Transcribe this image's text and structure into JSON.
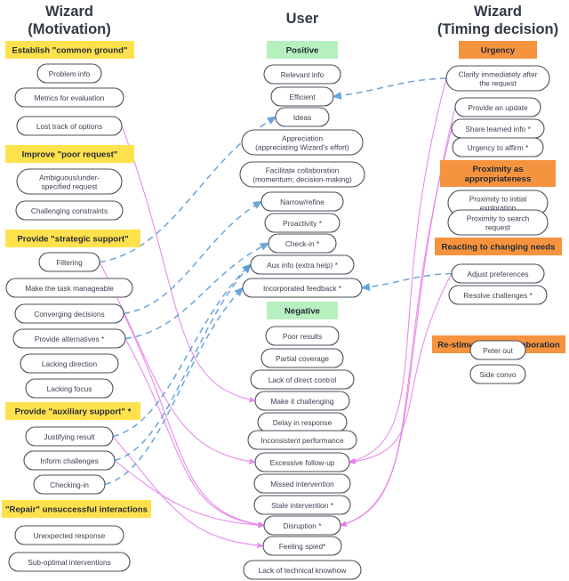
{
  "columns": [
    {
      "id": "wizard-motivation",
      "title": "Wizard\n(Motivation)",
      "title_lines": [
        "Wizard",
        "(Motivation)"
      ],
      "header_color": "#ffe14d",
      "groups": [
        {
          "header": "Establish \"common ground\"",
          "nodes": [
            "Problem info",
            "Metrics for evaluation",
            "Lost track of options"
          ]
        },
        {
          "header": "Improve \"poor request\"",
          "nodes": [
            "Ambiguous/under-\nspecified request",
            "Challenging constraints"
          ]
        },
        {
          "header": "Provide \"strategic support\"",
          "nodes": [
            "Filtering",
            "Make the task manageable",
            "Converging decisions",
            "Provide alternatives *",
            "Lacking direction",
            "Lacking focus"
          ]
        },
        {
          "header": "Provide \"auxiliary support\" *",
          "nodes": [
            "Justifying result",
            "Inform challenges",
            "Checking-in"
          ]
        },
        {
          "header": "\"Repair\" unsuccessful interactions",
          "nodes": [
            "Unexpected response",
            "Sub-optimal interventions"
          ]
        }
      ]
    },
    {
      "id": "user",
      "title": "User",
      "title_lines": [
        "User"
      ],
      "header_color": "#b6f0bf",
      "groups": [
        {
          "header": "Positive",
          "nodes": [
            "Relevant info",
            "Efficient",
            "Ideas",
            "Appreciation\n(appreciating Wizard's effort)",
            "Facilitate collaboration\n(momentum; decision-making)",
            "Narrow/refine",
            "Proactivity *",
            "Check-in *",
            "Aux info (extra help) *",
            "Incorporated feedback *"
          ]
        },
        {
          "header": "Negative",
          "nodes": [
            "Poor results",
            "Partial coverage",
            "Lack of direct control",
            "Make it challenging",
            "Delay in response",
            "Inconsistent performance",
            "Excessive follow-up",
            "Missed intervention",
            "Stale intervention *",
            "Disruption *",
            "Feeling spied*",
            "Lack of technical knowhow"
          ]
        }
      ]
    },
    {
      "id": "wizard-timing",
      "title": "Wizard\n(Timing decision)",
      "title_lines": [
        "Wizard",
        "(Timing decision)"
      ],
      "header_color": "#f5933f",
      "groups": [
        {
          "header": "Urgency",
          "nodes": [
            "Clarify immediately after\nthe request",
            "Provide an update",
            "Share learned info *",
            "Urgency to affirm *"
          ]
        },
        {
          "header": "Proximity as\nappropriateness",
          "nodes": [
            "Proximity to initial\nexploration",
            "Proximity to search\nrequest"
          ]
        },
        {
          "header": "Reacting to changing needs",
          "nodes": [
            "Adjust preferences",
            "Resolve challenges *"
          ]
        },
        {
          "header": "Re-stimulate the collaboration",
          "nodes": [
            "Peter out",
            "Side convo"
          ]
        }
      ]
    }
  ],
  "legend": {
    "pink_link_color": "#e57ae8",
    "blue_link_color": "#5b9bd5",
    "pill_border_color": "#4a4f59",
    "text_color": "#3b4250"
  },
  "links": [
    {
      "from": "Lost track of options",
      "to": "Make it challenging",
      "style": "pink"
    },
    {
      "from": "Filtering",
      "to": "Excessive follow-up",
      "style": "pink"
    },
    {
      "from": "Converging decisions",
      "to": "Disruption *",
      "style": "pink"
    },
    {
      "from": "Provide alternatives *",
      "to": "Disruption *",
      "style": "pink"
    },
    {
      "from": "Justifying result",
      "to": "Feeling spied*",
      "style": "pink"
    },
    {
      "from": "Inform challenges",
      "to": "Disruption *",
      "style": "pink"
    },
    {
      "from": "Clarify immediately after the request",
      "to": "Excessive follow-up",
      "style": "pink"
    },
    {
      "from": "Provide an update",
      "to": "Disruption *",
      "style": "pink"
    },
    {
      "from": "Share learned info *",
      "to": "Disruption *",
      "style": "pink"
    },
    {
      "from": "Adjust preferences",
      "to": "Excessive follow-up",
      "style": "pink"
    },
    {
      "from": "Clarify immediately after the request",
      "to": "Efficient",
      "style": "blue"
    },
    {
      "from": "Filtering",
      "to": "Ideas",
      "style": "blue"
    },
    {
      "from": "Converging decisions",
      "to": "Narrow/refine",
      "style": "blue"
    },
    {
      "from": "Provide alternatives *",
      "to": "Check-in *",
      "style": "blue"
    },
    {
      "from": "Justifying result",
      "to": "Aux info (extra help) *",
      "style": "blue"
    },
    {
      "from": "Inform challenges",
      "to": "Aux info (extra help) *",
      "style": "blue"
    },
    {
      "from": "Checking-in",
      "to": "Incorporated feedback *",
      "style": "blue"
    },
    {
      "from": "Adjust preferences",
      "to": "Incorporated feedback *",
      "style": "blue"
    }
  ]
}
